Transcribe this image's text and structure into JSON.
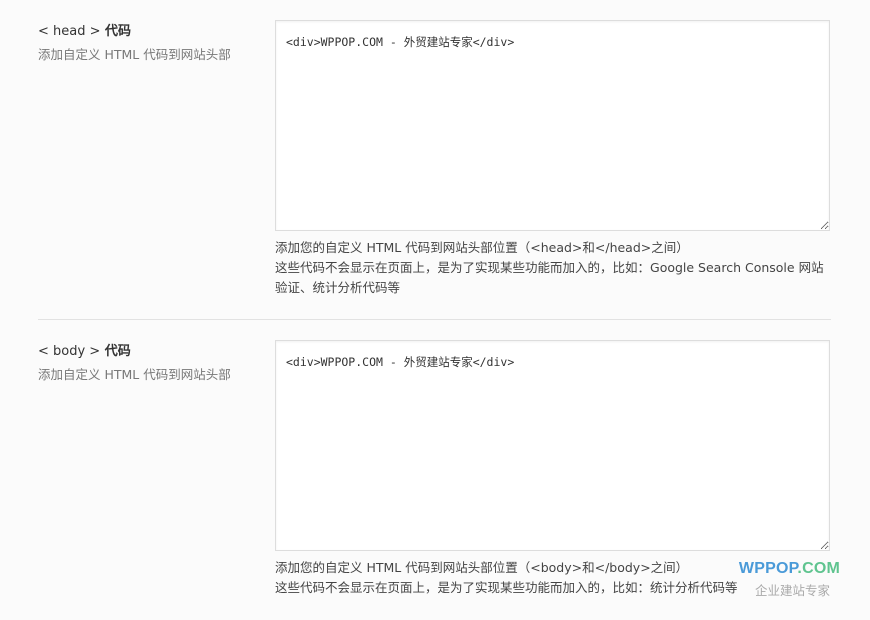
{
  "sections": [
    {
      "title_tag": "< head >",
      "title_suffix": "代码",
      "description": "添加自定义 HTML 代码到网站头部",
      "code_value": "<div>WPPOP.COM - 外贸建站专家</div>",
      "help_lines": [
        "添加您的自定义 HTML 代码到网站头部位置（<head>和</head>之间）",
        "这些代码不会显示在页面上，是为了实现某些功能而加入的，比如：Google Search Console 网站",
        "验证、统计分析代码等"
      ]
    },
    {
      "title_tag": "< body >",
      "title_suffix": "代码",
      "description": "添加自定义 HTML 代码到网站头部",
      "code_value": "<div>WPPOP.COM - 外贸建站专家</div>",
      "help_lines": [
        "添加您的自定义 HTML 代码到网站头部位置（<body>和</body>之间）",
        "这些代码不会显示在页面上，是为了实现某些功能而加入的，比如：统计分析代码等"
      ]
    }
  ],
  "watermark": {
    "brand_part1": "WPPOP",
    "brand_part2": ".COM",
    "tagline": "企业建站专家",
    "color_primary": "#4a9ad8",
    "color_secondary": "#5fc48f"
  },
  "icons": {
    "resize_grip": "resize-grip-icon"
  }
}
